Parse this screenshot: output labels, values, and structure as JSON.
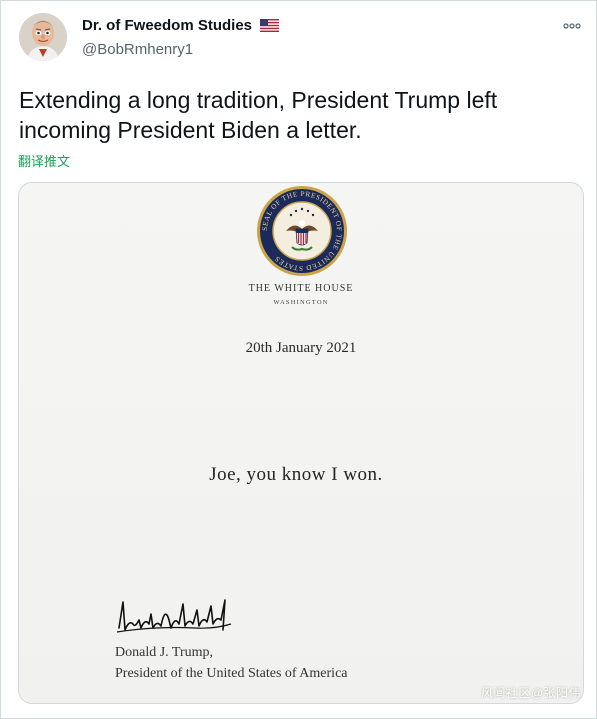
{
  "tweet": {
    "display_name": "Dr. of Fweedom Studies",
    "handle": "@BobRmhenry1",
    "text": "Extending a long tradition, President Trump left incoming President Biden a letter.",
    "translate_label": "翻译推文",
    "more_icon": "more-horizontal-icon",
    "flag_icon": "us-flag-emoji",
    "avatar_icon": "avatar-image"
  },
  "letter": {
    "letterhead_title": "THE WHITE HOUSE",
    "letterhead_subtitle": "WASHINGTON",
    "seal_text": "SEAL OF THE PRESIDENT OF THE UNITED STATES",
    "date": "20th January 2021",
    "message": "Joe, you know I won.",
    "signature_name": "Donald J. Trump,",
    "signature_title": "President of the United States of America"
  },
  "watermark": "风闻社区@张阳伟",
  "colors": {
    "translate_link": "#1da15a",
    "text_primary": "#0f1419",
    "text_secondary": "#536471",
    "seal_gold": "#c9a449",
    "seal_navy": "#1b2a5a"
  }
}
